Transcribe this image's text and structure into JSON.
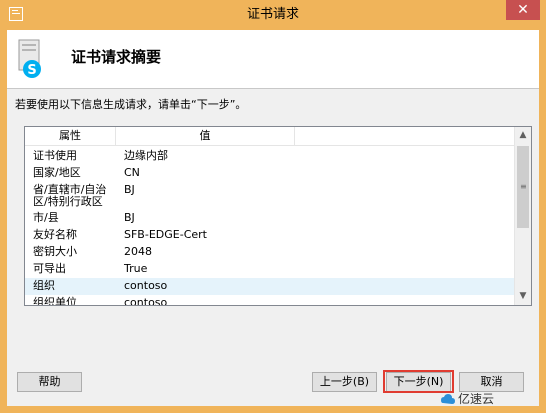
{
  "window": {
    "title": "证书请求",
    "close_symbol": "✕"
  },
  "header": {
    "title": "证书请求摘要",
    "icon": "skype-certificate-icon"
  },
  "instruction": "若要使用以下信息生成请求，请单击“下一步”。",
  "table": {
    "columns": [
      "属性",
      "值"
    ],
    "rows": [
      {
        "property": "证书使用",
        "value": "边缘内部"
      },
      {
        "property": "国家/地区",
        "value": "CN"
      },
      {
        "property": "省/直辖市/自治区/特别行政区",
        "value": "BJ"
      },
      {
        "property": "市/县",
        "value": "BJ"
      },
      {
        "property": "友好名称",
        "value": "SFB-EDGE-Cert"
      },
      {
        "property": "密钥大小",
        "value": "2048"
      },
      {
        "property": "可导出",
        "value": "True"
      },
      {
        "property": "组织",
        "value": "contoso"
      },
      {
        "property": "组织单位",
        "value": "contoso"
      }
    ]
  },
  "scrollbar": {
    "up": "▲",
    "down": "▼",
    "grip": "≡"
  },
  "buttons": {
    "help": "帮助",
    "back": "上一步(B)",
    "next": "下一步(N)",
    "cancel": "取消"
  },
  "watermark": {
    "text": "亿速云"
  },
  "colors": {
    "titlebar": "#f0b45a",
    "close": "#c75050",
    "highlight": "#e03c31",
    "selected_row": "#e5f3fb"
  }
}
